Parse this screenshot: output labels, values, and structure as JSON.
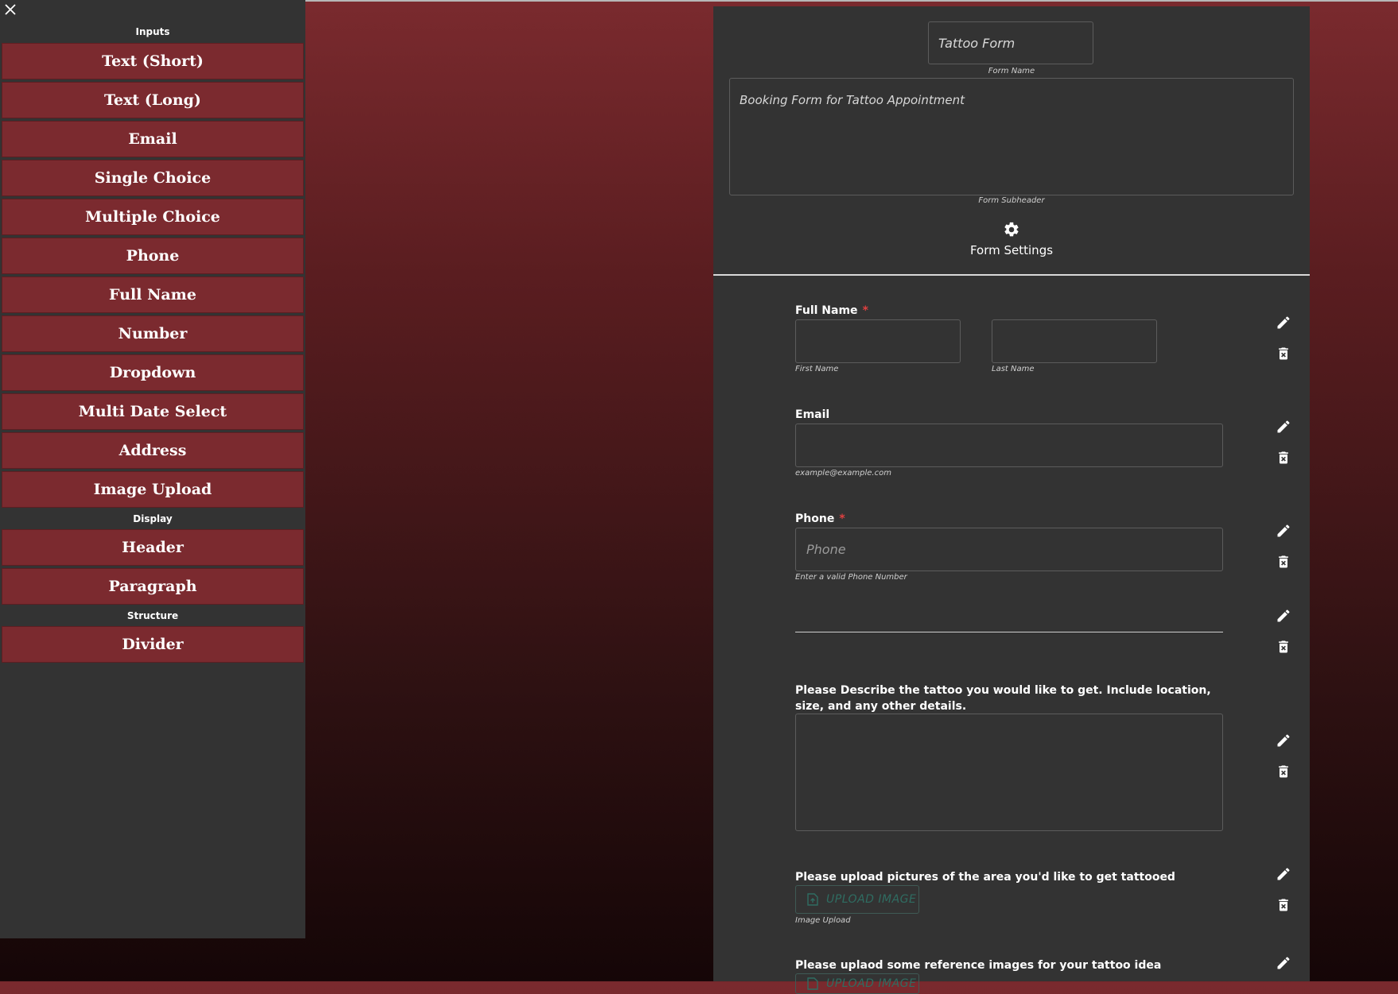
{
  "sidebar": {
    "sections": [
      {
        "title": "Inputs",
        "items": [
          "Text (Short)",
          "Text (Long)",
          "Email",
          "Single Choice",
          "Multiple Choice",
          "Phone",
          "Full Name",
          "Number",
          "Dropdown",
          "Multi Date Select",
          "Address",
          "Image Upload"
        ]
      },
      {
        "title": "Display",
        "items": [
          "Header",
          "Paragraph"
        ]
      },
      {
        "title": "Structure",
        "items": [
          "Divider"
        ]
      }
    ]
  },
  "form": {
    "name_value": "Tattoo Form",
    "name_label": "Form Name",
    "subheader_value": "Booking Form for Tattoo Appointment",
    "subheader_label": "Form Subheader",
    "settings_label": "Form Settings"
  },
  "fields": {
    "full_name": {
      "label": "Full Name",
      "required": "*",
      "first_label": "First Name",
      "last_label": "Last Name"
    },
    "email": {
      "label": "Email",
      "helper": "example@example.com"
    },
    "phone": {
      "label": "Phone",
      "required": "*",
      "placeholder": "Phone",
      "helper": "Enter a valid Phone Number"
    },
    "describe": {
      "label": "Please Describe the tattoo you would like to get. Include location, size, and any other details."
    },
    "upload_area": {
      "label": "Please upload pictures of the area you'd like to get tattooed",
      "button": "UPLOAD IMAGE",
      "helper": "Image Upload"
    },
    "upload_ref": {
      "label": "Please uplaod some reference images for your tattoo idea",
      "button": "UPLOAD IMAGE"
    }
  },
  "colors": {
    "accent": "#7b2a2f",
    "panel": "#333333",
    "required": "#e04040",
    "upload_text": "#2f6d62"
  },
  "icons": {
    "close": "close-icon",
    "settings": "gear-icon",
    "edit": "pencil-icon",
    "delete": "trash-icon",
    "upload": "upload-file-icon"
  }
}
